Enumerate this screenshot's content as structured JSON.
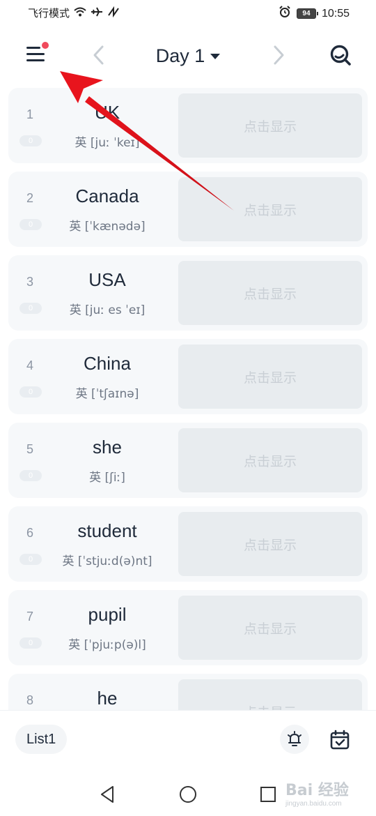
{
  "status_bar": {
    "mode_text": "飞行模式",
    "battery": "94",
    "time": "10:55"
  },
  "header": {
    "title": "Day 1",
    "icons": [
      "menu-icon",
      "chevron-left-icon",
      "caret-down-icon",
      "chevron-right-icon",
      "search-icon"
    ]
  },
  "words": [
    {
      "num": "1",
      "count": "0",
      "word": "UK",
      "phonetic": "英 [juː ˈkeɪ]",
      "reveal": "点击显示"
    },
    {
      "num": "2",
      "count": "0",
      "word": "Canada",
      "phonetic": "英 [ˈkænədə]",
      "reveal": "点击显示"
    },
    {
      "num": "3",
      "count": "0",
      "word": "USA",
      "phonetic": "英 [juː es ˈeɪ]",
      "reveal": "点击显示"
    },
    {
      "num": "4",
      "count": "0",
      "word": "China",
      "phonetic": "英 [ˈtʃaɪnə]",
      "reveal": "点击显示"
    },
    {
      "num": "5",
      "count": "0",
      "word": "she",
      "phonetic": "英 [ʃiː]",
      "reveal": "点击显示"
    },
    {
      "num": "6",
      "count": "0",
      "word": "student",
      "phonetic": "英 [ˈstjuːd(ə)nt]",
      "reveal": "点击显示"
    },
    {
      "num": "7",
      "count": "0",
      "word": "pupil",
      "phonetic": "英 [ˈpjuːp(ə)l]",
      "reveal": "点击显示"
    },
    {
      "num": "8",
      "count": "",
      "word": "he",
      "phonetic": "",
      "reveal": "点击显示"
    }
  ],
  "bottom_bar": {
    "list_label": "List1",
    "icons": [
      "alarm-icon",
      "calendar-check-icon"
    ]
  },
  "watermark": {
    "logo": "Bai 经验",
    "sub": "jingyan.baidu.com"
  },
  "colors": {
    "text_primary": "#1f2a3a",
    "card_bg": "#f6f8fa",
    "reveal_bg": "#e8ecef",
    "reveal_text": "#c9cfd5",
    "badge_dot": "#f04a5c",
    "annotation_arrow": "#e8141d"
  }
}
